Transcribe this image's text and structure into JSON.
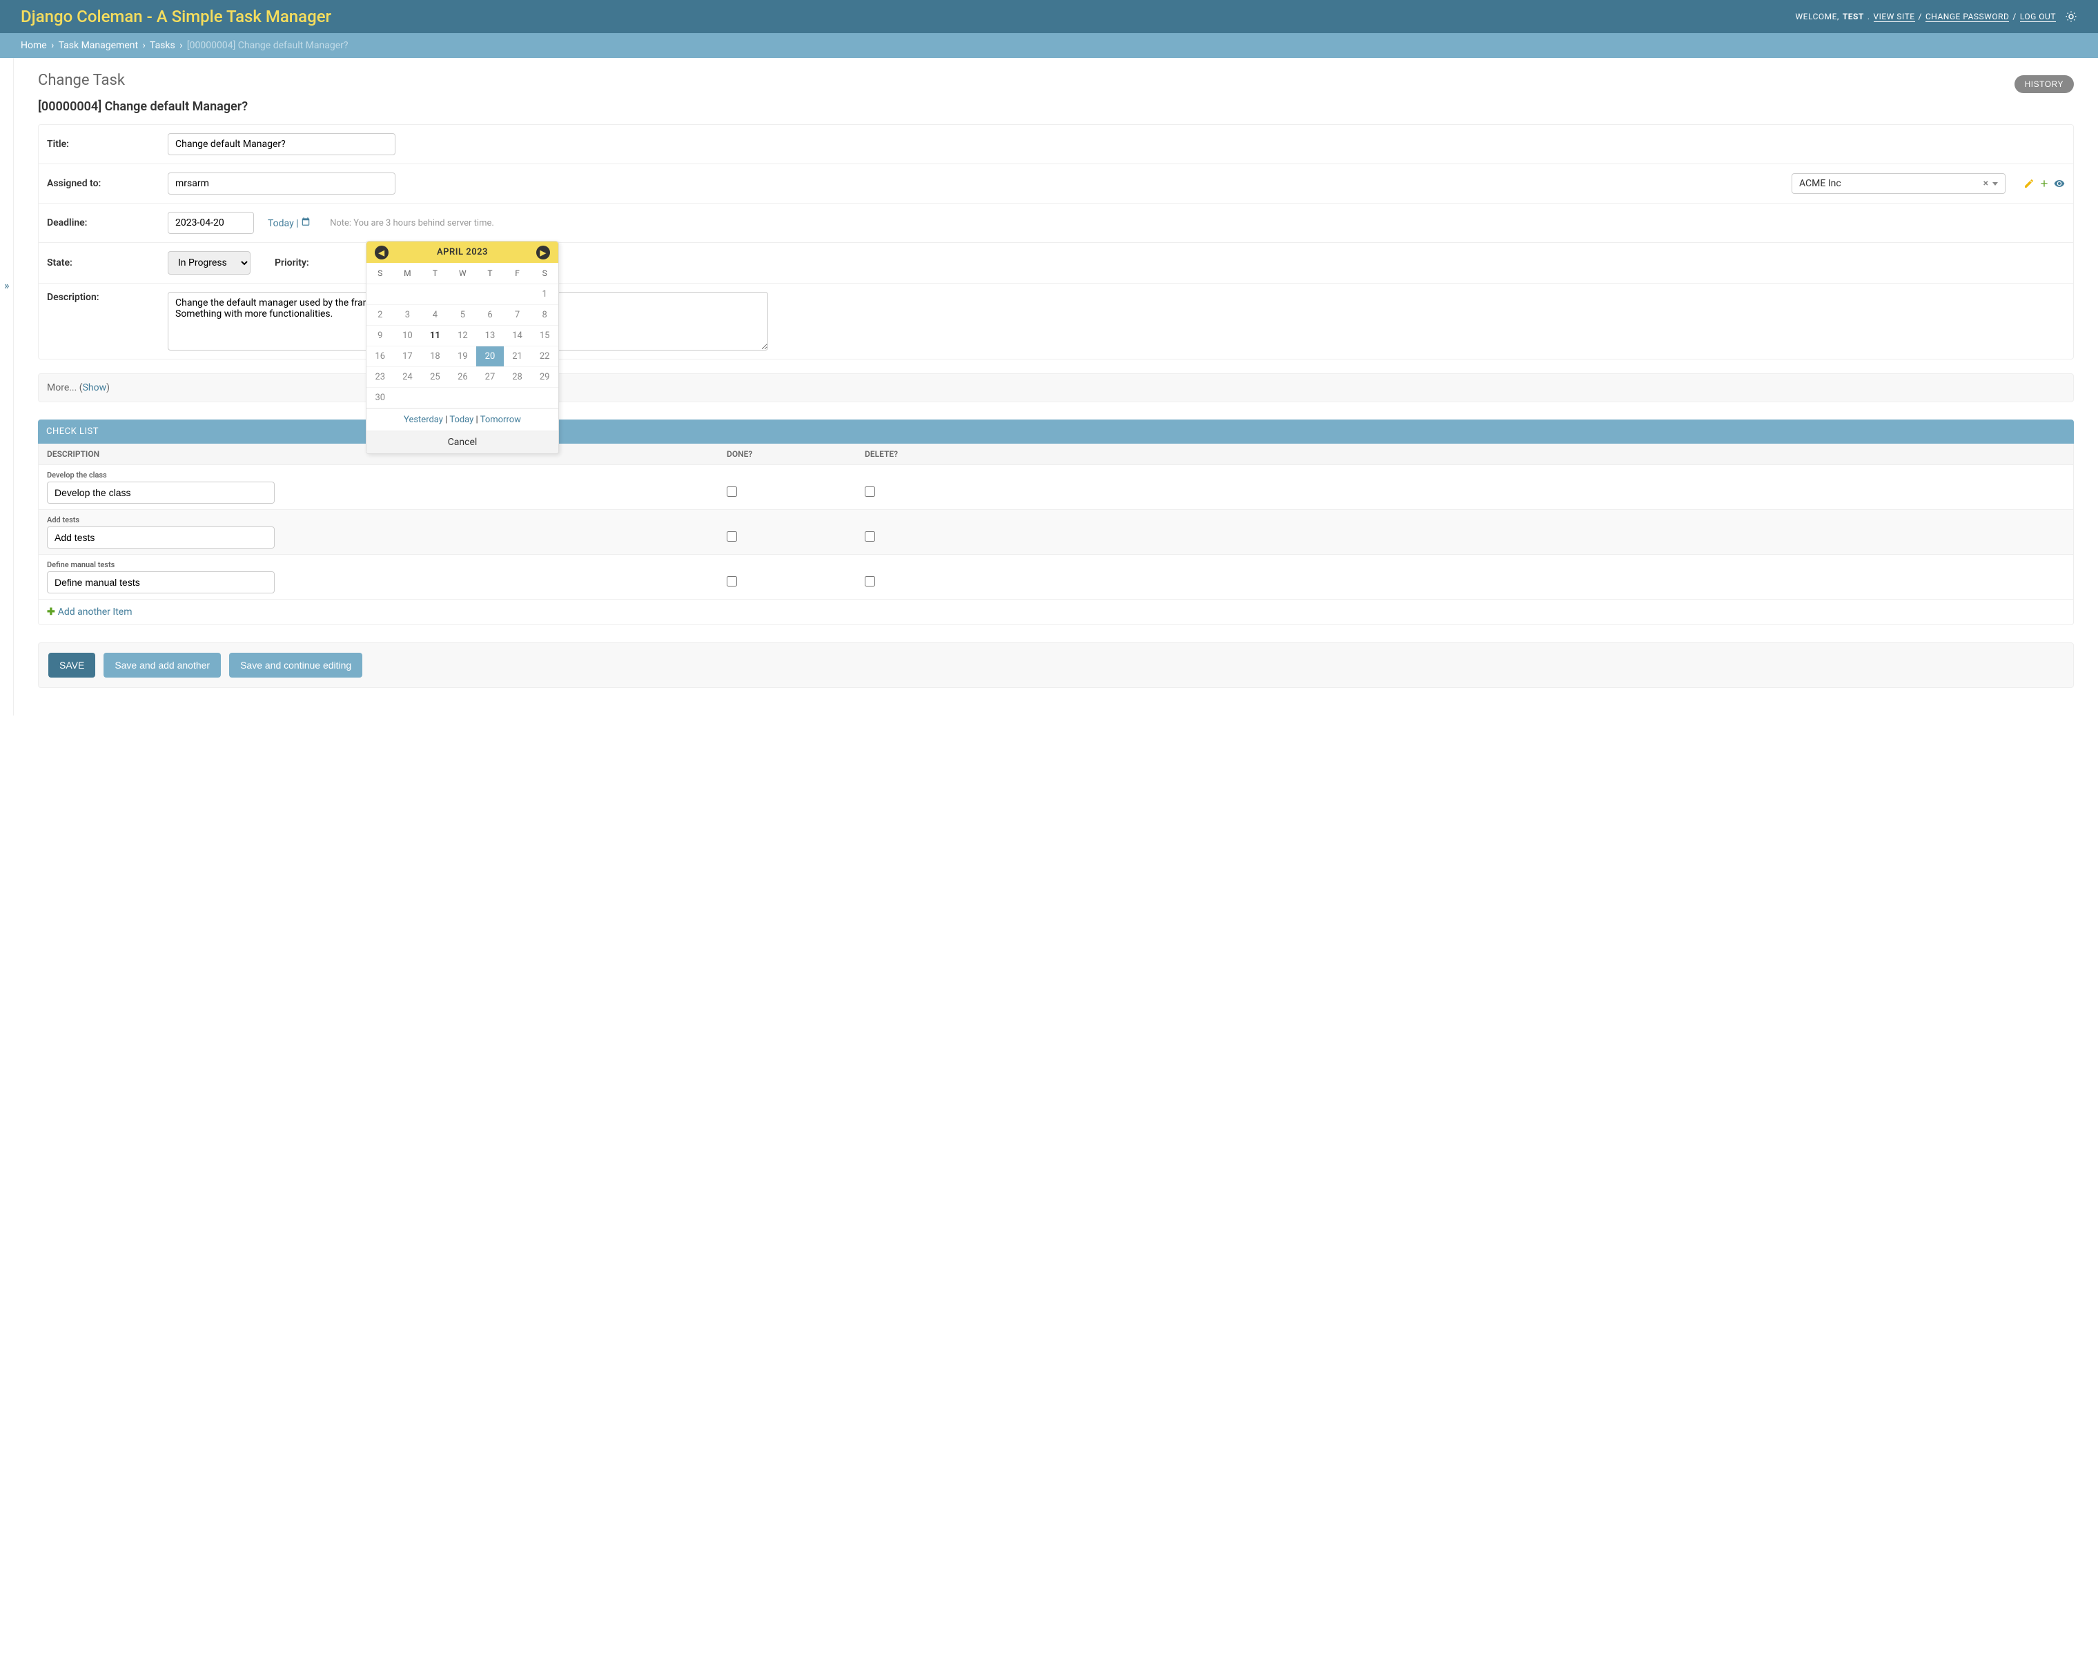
{
  "header": {
    "title": "Django Coleman - A Simple Task Manager",
    "welcome": "WELCOME, ",
    "user": "TEST",
    "view_site": "VIEW SITE",
    "change_password": "CHANGE PASSWORD",
    "log_out": "LOG OUT"
  },
  "breadcrumbs": {
    "home": "Home",
    "app": "Task Management",
    "model": "Tasks",
    "current": "[00000004] Change default Manager?"
  },
  "page": {
    "heading": "Change Task",
    "object": "[00000004] Change default Manager?",
    "history": "HISTORY"
  },
  "labels": {
    "title": "Title:",
    "assigned_to": "Assigned to:",
    "deadline": "Deadline:",
    "state": "State:",
    "priority": "Priority:",
    "description": "Description:",
    "today": "Today",
    "note": "Note: You are 3 hours behind server time."
  },
  "fields": {
    "title": "Change default Manager?",
    "assigned_to": "mrsarm",
    "partner": "ACME Inc",
    "deadline": "2023-04-20",
    "state": "In Progress",
    "description": "Change the default manager used by the framework.\nSomething with more functionalities."
  },
  "collapse": {
    "prefix": "More... (",
    "link": "Show",
    "suffix": ")"
  },
  "checklist": {
    "title": "CHECK LIST",
    "col_desc": "DESCRIPTION",
    "col_done": "DONE?",
    "col_delete": "DELETE?",
    "items": [
      {
        "label": "Develop the class",
        "value": "Develop the class"
      },
      {
        "label": "Add tests",
        "value": "Add tests"
      },
      {
        "label": "Define manual tests",
        "value": "Define manual tests"
      }
    ],
    "add": "Add another Item"
  },
  "submit": {
    "save": "SAVE",
    "save_add": "Save and add another",
    "save_cont": "Save and continue editing"
  },
  "calendar": {
    "header": "APRIL 2023",
    "dow": [
      "S",
      "M",
      "T",
      "W",
      "T",
      "F",
      "S"
    ],
    "weeks": [
      [
        "",
        "",
        "",
        "",
        "",
        "",
        "1"
      ],
      [
        "2",
        "3",
        "4",
        "5",
        "6",
        "7",
        "8"
      ],
      [
        "9",
        "10",
        "11",
        "12",
        "13",
        "14",
        "15"
      ],
      [
        "16",
        "17",
        "18",
        "19",
        "20",
        "21",
        "22"
      ],
      [
        "23",
        "24",
        "25",
        "26",
        "27",
        "28",
        "29"
      ],
      [
        "30",
        "",
        "",
        "",
        "",
        "",
        ""
      ]
    ],
    "today_day": "11",
    "selected_day": "20",
    "yesterday": "Yesterday",
    "today": "Today",
    "tomorrow": "Tomorrow",
    "cancel": "Cancel"
  }
}
